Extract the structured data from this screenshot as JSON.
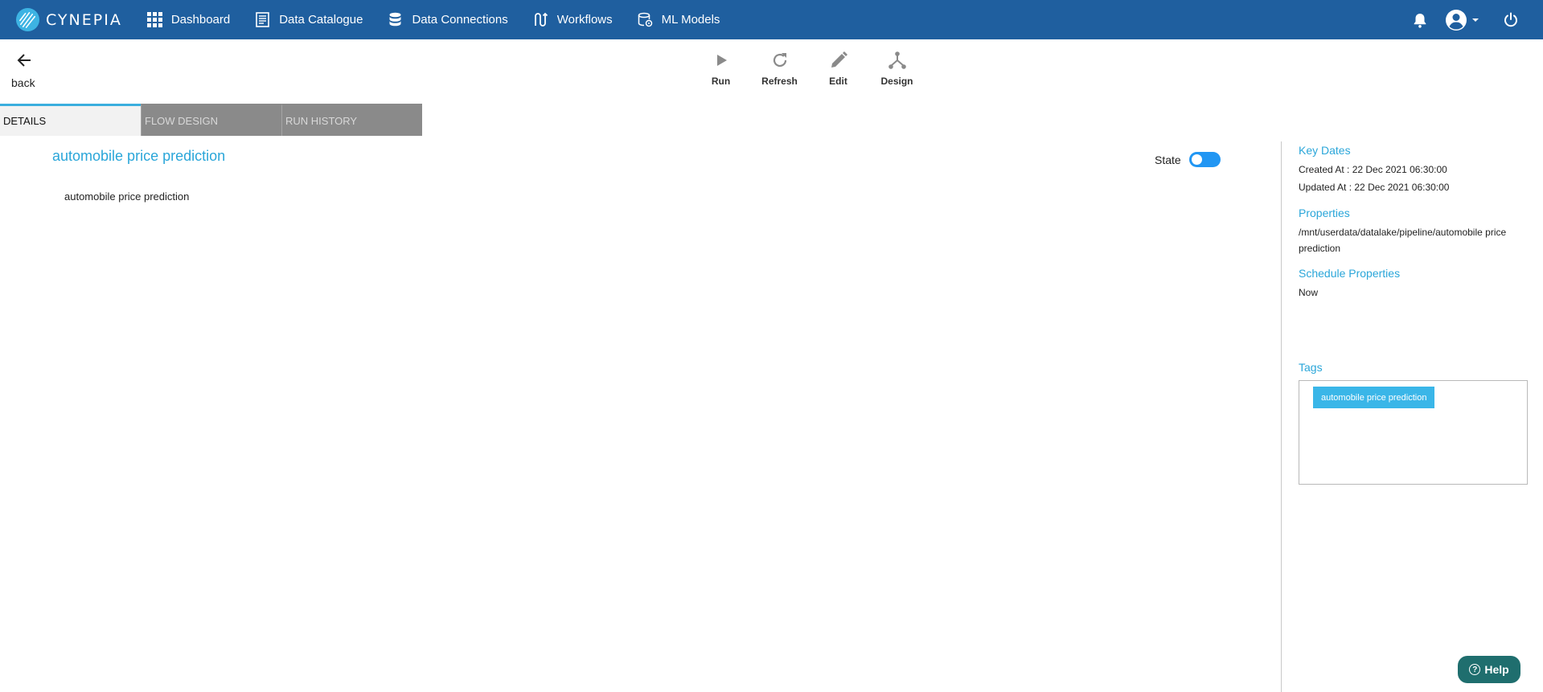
{
  "brand": {
    "name": "CYNEPIA"
  },
  "nav": {
    "items": [
      {
        "label": "Dashboard",
        "icon": "grid-icon"
      },
      {
        "label": "Data Catalogue",
        "icon": "catalogue-icon"
      },
      {
        "label": "Data Connections",
        "icon": "database-icon"
      },
      {
        "label": "Workflows",
        "icon": "workflow-icon"
      },
      {
        "label": "ML Models",
        "icon": "ml-model-icon"
      }
    ],
    "right_icons": [
      "bell-icon",
      "account-icon",
      "power-icon"
    ]
  },
  "back": {
    "label": "back"
  },
  "toolbar": {
    "run": "Run",
    "refresh": "Refresh",
    "edit": "Edit",
    "design": "Design"
  },
  "tabs": [
    {
      "label": "DETAILS",
      "active": true
    },
    {
      "label": "FLOW DESIGN",
      "active": false
    },
    {
      "label": "RUN HISTORY",
      "active": false
    }
  ],
  "details": {
    "title": "automobile price prediction",
    "description": "automobile price prediction",
    "state_label": "State",
    "state_on": true
  },
  "side": {
    "key_dates_title": "Key Dates",
    "created_at": "Created At : 22 Dec 2021 06:30:00",
    "updated_at": "Updated At : 22 Dec 2021 06:30:00",
    "properties_title": "Properties",
    "properties_path": "/mnt/userdata/datalake/pipeline/automobile price prediction",
    "schedule_title": "Schedule Properties",
    "schedule_value": "Now",
    "tags_title": "Tags",
    "tags": [
      "automobile price prediction"
    ]
  },
  "help": {
    "label": "Help"
  },
  "colors": {
    "navbar": "#1f5f9f",
    "accent": "#2aa6d9",
    "toggle": "#2196f3",
    "help": "#1f6e6e"
  }
}
